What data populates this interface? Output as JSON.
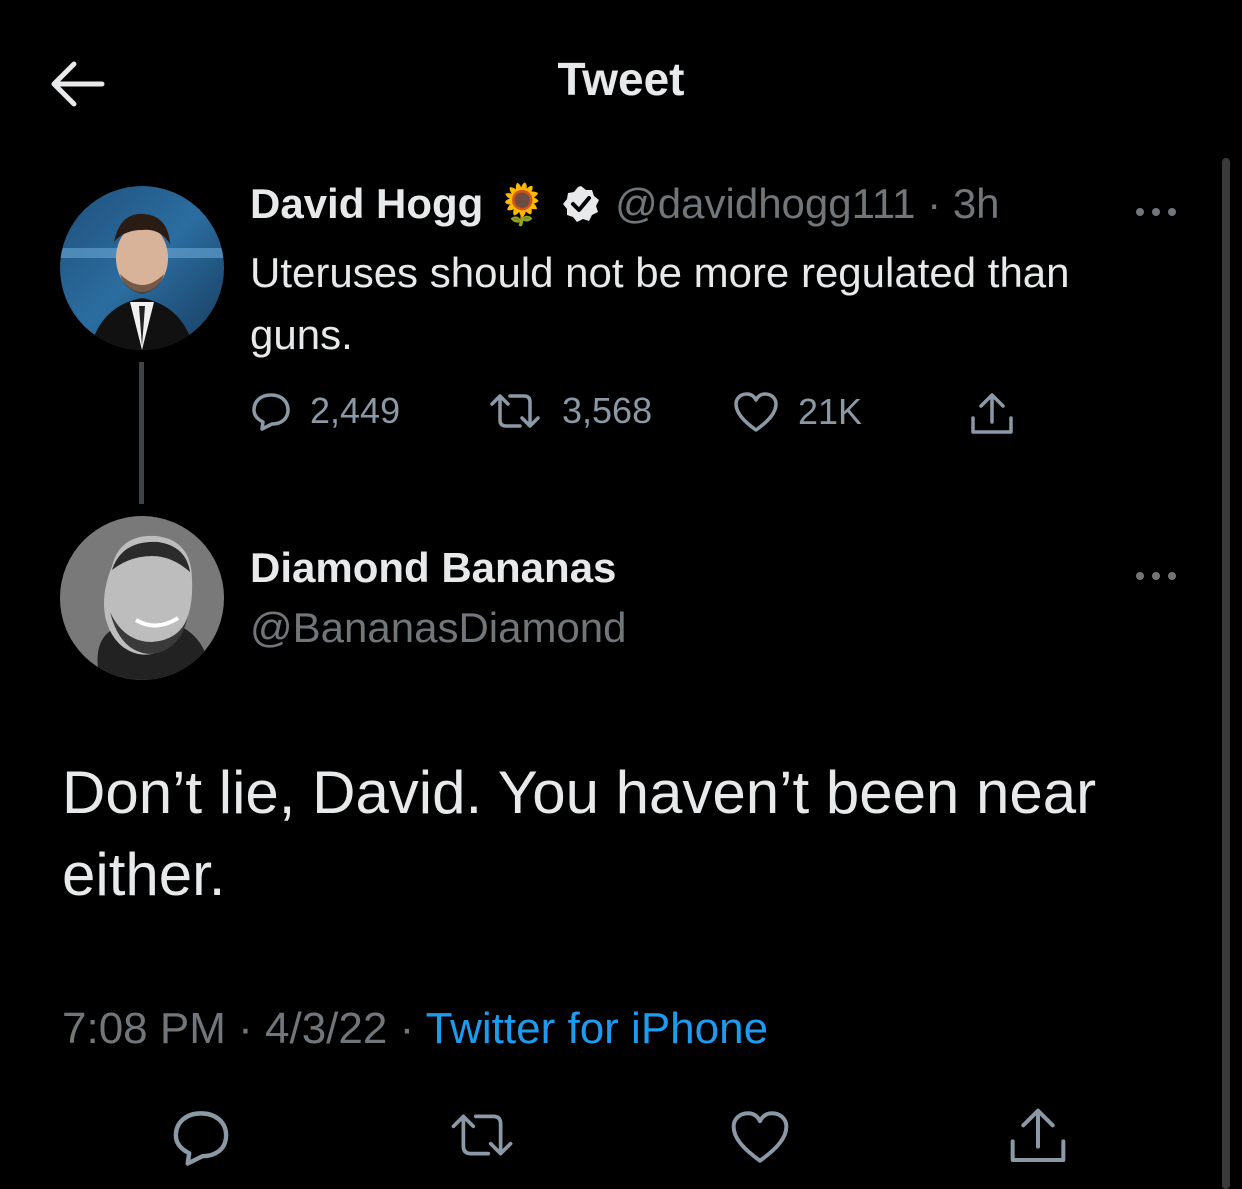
{
  "header": {
    "title": "Tweet"
  },
  "original_tweet": {
    "author_name": "David Hogg",
    "emoji": "🌻",
    "handle": "@davidhogg111",
    "separator": "·",
    "age": "3h",
    "text": "Uteruses should not be more regulated than guns.",
    "stats": {
      "replies": "2,449",
      "retweets": "3,568",
      "likes": "21K"
    }
  },
  "reply_tweet": {
    "author_name": "Diamond Bananas",
    "handle": "@BananasDiamond",
    "text": "Don’t lie, David. You haven’t been near either.",
    "time": "7:08 PM",
    "date": "4/3/22",
    "source": "Twitter for iPhone",
    "separator": "·"
  },
  "colors": {
    "background": "#000000",
    "text": "#e7e9ea",
    "muted": "#71767b",
    "link": "#1d9bf0"
  }
}
